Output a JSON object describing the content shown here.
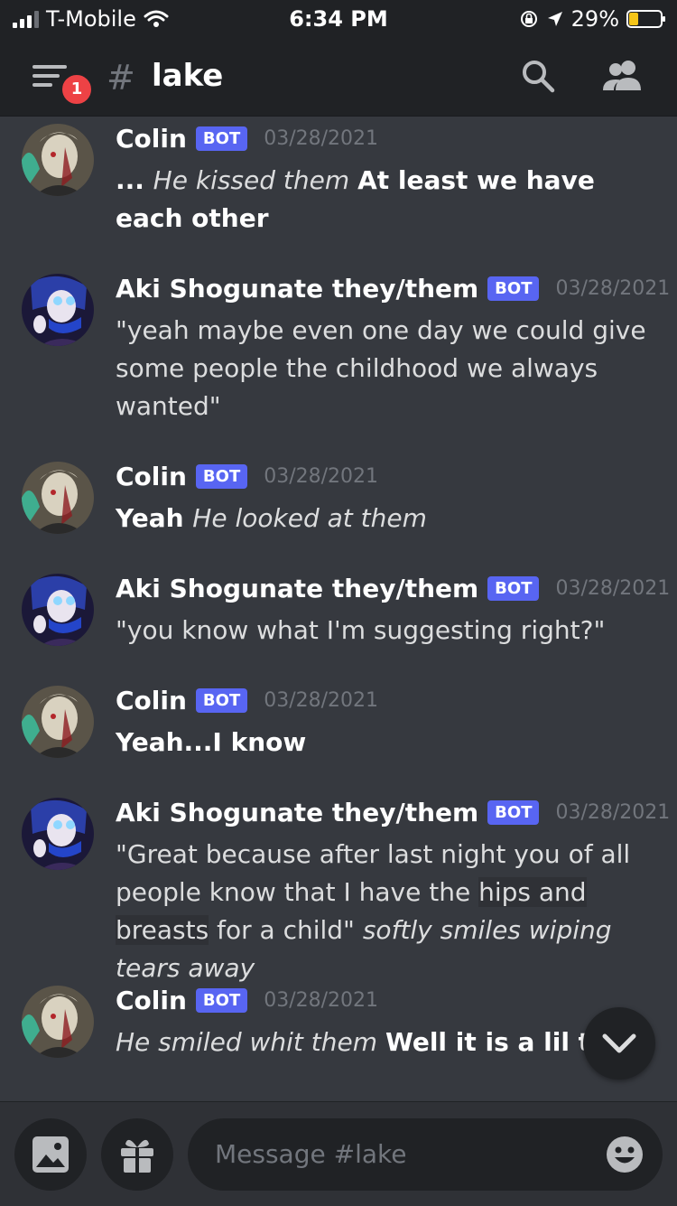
{
  "status_bar": {
    "carrier": "T-Mobile",
    "time": "6:34 PM",
    "battery": "29%"
  },
  "header": {
    "notification_count": "1",
    "hash": "#",
    "channel": "lake"
  },
  "messages": [
    {
      "author": "Colin",
      "bot_tag": "BOT",
      "date": "03/28/2021",
      "avatar": "colin-avatar",
      "parts": [
        {
          "t": "... ",
          "s": "bold"
        },
        {
          "t": "He kissed them ",
          "s": "italic"
        },
        {
          "t": "At least we have each other",
          "s": "bold"
        }
      ]
    },
    {
      "author": "Aki Shogunate they/them",
      "bot_tag": "BOT",
      "date": "03/28/2021",
      "avatar": "aki-avatar",
      "parts": [
        {
          "t": "\"yeah maybe even one day  we could give some people the childhood we always wanted\"",
          "s": "normal"
        }
      ]
    },
    {
      "author": "Colin",
      "bot_tag": "BOT",
      "date": "03/28/2021",
      "avatar": "colin-avatar",
      "parts": [
        {
          "t": "Yeah ",
          "s": "bold"
        },
        {
          "t": "He looked at them",
          "s": "italic"
        }
      ]
    },
    {
      "author": "Aki Shogunate they/them",
      "bot_tag": "BOT",
      "date": "03/28/2021",
      "avatar": "aki-avatar",
      "parts": [
        {
          "t": "\"you know what I'm suggesting right?\"",
          "s": "normal"
        }
      ]
    },
    {
      "author": "Colin",
      "bot_tag": "BOT",
      "date": "03/28/2021",
      "avatar": "colin-avatar",
      "parts": [
        {
          "t": "Yeah...I know",
          "s": "bold"
        }
      ]
    },
    {
      "author": "Aki Shogunate they/them",
      "bot_tag": "BOT",
      "date": "03/28/2021",
      "avatar": "aki-avatar",
      "parts": [
        {
          "t": "\"Great because after last  night you of all people know that I have the ",
          "s": "normal"
        },
        {
          "t": "hips and breasts",
          "s": "highlight"
        },
        {
          "t": " for a child\" ",
          "s": "normal"
        },
        {
          "t": "softly smiles wiping tears away",
          "s": "italic"
        }
      ]
    },
    {
      "author": "Colin",
      "bot_tag": "BOT",
      "date": "03/28/2021",
      "avatar": "colin-avatar",
      "parts": [
        {
          "t": "He smiled whit them ",
          "s": "italic"
        },
        {
          "t": "Well it is a lil to soo",
          "s": "bold"
        }
      ]
    }
  ],
  "composer": {
    "placeholder": "Message #lake"
  },
  "colors": {
    "background": "#36393f",
    "bars": "#202225",
    "bot_badge": "#5865f2",
    "notification": "#ed4245"
  }
}
